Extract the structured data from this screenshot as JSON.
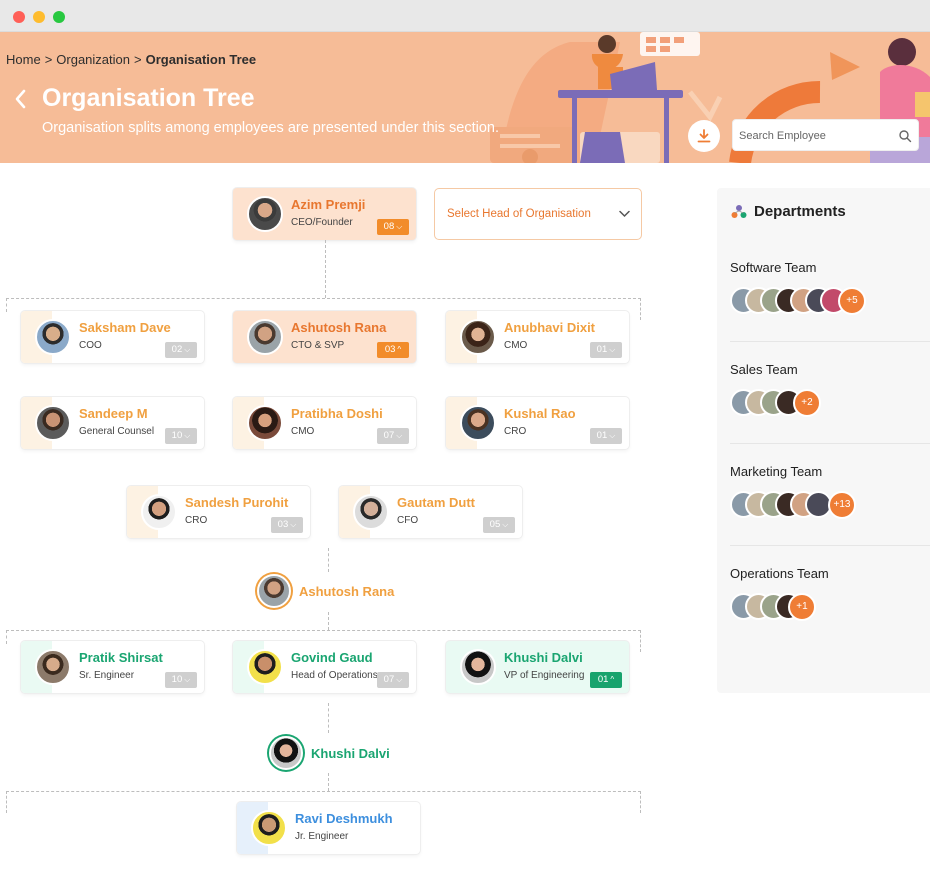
{
  "breadcrumb": {
    "home": "Home",
    "organization": "Organization",
    "current": "Organisation Tree",
    "separator": ">"
  },
  "header": {
    "title": "Organisation Tree",
    "subtitle": "Organisation splits among employees are presented under this section.",
    "search_placeholder": "Search Employee"
  },
  "head_select": {
    "label": "Select Head of Organisation"
  },
  "ceo": {
    "name": "Azim Premji",
    "role": "CEO/Founder",
    "count": "08"
  },
  "level1": [
    {
      "name": "Saksham Dave",
      "role": "COO",
      "count": "02"
    },
    {
      "name": "Ashutosh Rana",
      "role": "CTO & SVP",
      "count": "03"
    },
    {
      "name": "Anubhavi Dixit",
      "role": "CMO",
      "count": "01"
    },
    {
      "name": "Sandeep M",
      "role": "General Counsel",
      "count": "10"
    },
    {
      "name": "Pratibha Doshi",
      "role": "CMO",
      "count": "07"
    },
    {
      "name": "Kushal Rao",
      "role": "CRO",
      "count": "01"
    },
    {
      "name": "Sandesh Purohit",
      "role": "CRO",
      "count": "03"
    },
    {
      "name": "Gautam Dutt",
      "role": "CFO",
      "count": "05"
    }
  ],
  "level2_head": {
    "name": "Ashutosh Rana"
  },
  "level2": [
    {
      "name": "Pratik Shirsat",
      "role": "Sr. Engineer",
      "count": "10"
    },
    {
      "name": "Govind Gaud",
      "role": "Head of Operations",
      "count": "07"
    },
    {
      "name": "Khushi Dalvi",
      "role": "VP of Engineering",
      "count": "01"
    }
  ],
  "level3_head": {
    "name": "Khushi Dalvi"
  },
  "level3": [
    {
      "name": "Ravi Deshmukh",
      "role": "Jr. Engineer"
    }
  ],
  "departments": {
    "title": "Departments",
    "items": [
      {
        "name": "Software Team",
        "more": "+5"
      },
      {
        "name": "Sales Team",
        "more": "+2"
      },
      {
        "name": "Marketing Team",
        "more": "+13"
      },
      {
        "name": "Operations Team",
        "more": "+1"
      }
    ]
  },
  "colors": {
    "accent": "#ef7d35",
    "header_bg": "#f6bc97",
    "green": "#1aa571",
    "blue": "#3d8fde"
  },
  "icons": [
    "back-chevron-icon",
    "download-icon",
    "search-icon",
    "chevron-down-icon",
    "chevron-up-icon",
    "departments-icon"
  ]
}
